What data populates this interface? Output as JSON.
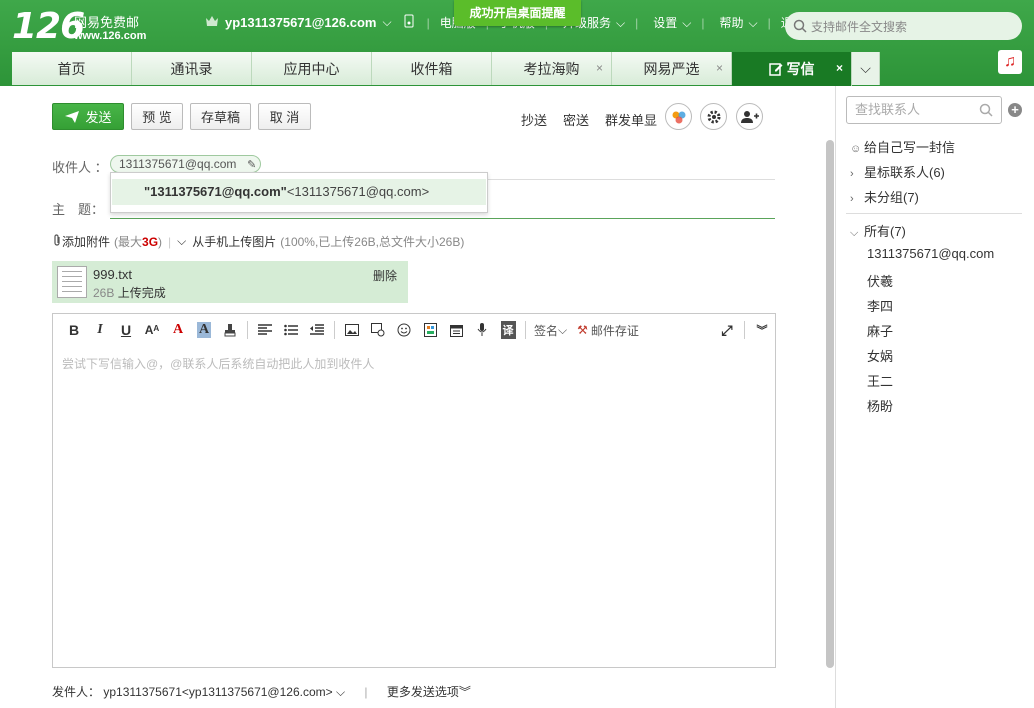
{
  "brand": {
    "number": "126",
    "name": "网易免费邮",
    "url": "www.126.com"
  },
  "user": {
    "email": "yp1311375671@126.com"
  },
  "topmenu": {
    "m1": "电脑版",
    "m2": "手机版",
    "upgrade": "升级服务",
    "settings": "设置",
    "help": "帮助",
    "logout": "退出"
  },
  "notice": "成功开启桌面提醒",
  "search": {
    "placeholder": "支持邮件全文搜索"
  },
  "tabs": {
    "home": "首页",
    "contacts": "通讯录",
    "apps": "应用中心",
    "inbox": "收件箱",
    "kaola": "考拉海购",
    "yanxuan": "网易严选",
    "compose": "写信"
  },
  "toolbar": {
    "send": "发送",
    "preview": "预 览",
    "draft": "存草稿",
    "cancel": "取 消",
    "cc": "抄送",
    "bcc": "密送",
    "separate": "群发单显"
  },
  "compose": {
    "to_label": "收件人 ：",
    "to_chip": "1311375671@qq.com",
    "subject_label": "主　题：",
    "suggestion_name": "\"1311375671@qq.com\"",
    "suggestion_addr": "<1311375671@qq.com>",
    "attach": "添加附件",
    "attach_limit_pre": "(最大",
    "attach_limit_val": "3G",
    "attach_limit_post": ")",
    "phone_upload": "从手机上传图片",
    "upload_status": "(100%,已上传26B,总文件大小26B)",
    "file_name": "999.txt",
    "file_size": "26B",
    "file_status": "上传完成",
    "delete": "删除",
    "signature": "签名",
    "save_mail": "邮件存证",
    "body_placeholder": "尝试下写信输入@，@联系人后系统自动把此人加到收件人",
    "sender_label": "发件人：",
    "sender_name": "yp1311375671",
    "sender_addr": "<yp1311375671@126.com>",
    "more_options": "更多发送选项"
  },
  "sidebar": {
    "search_placeholder": "查找联系人",
    "self": "给自己写一封信",
    "starred": "星标联系人(6)",
    "ungrouped": "未分组(7)",
    "all": "所有(7)",
    "contacts": [
      "1311375671@qq.com",
      "伏羲",
      "李四",
      "麻子",
      "女娲",
      "王二",
      "杨盼"
    ]
  }
}
